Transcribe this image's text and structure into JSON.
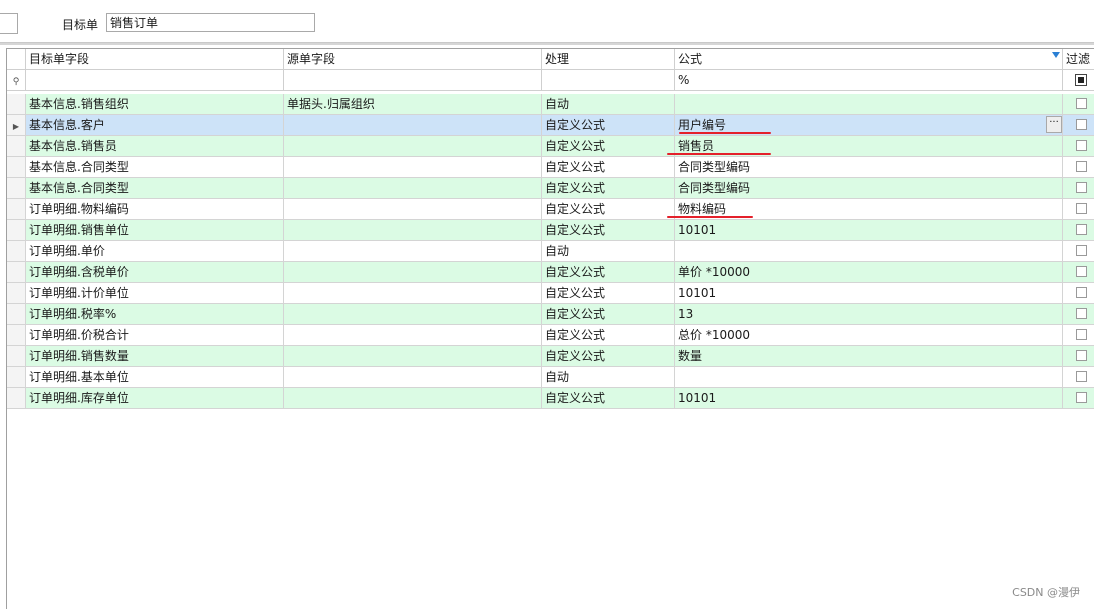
{
  "toolbar": {
    "target_label": "目标单",
    "target_value": "销售订单"
  },
  "grid": {
    "columns": [
      "目标单字段",
      "源单字段",
      "处理",
      "公式",
      "过滤"
    ],
    "filter_row": {
      "formula": "%"
    },
    "rows": [
      {
        "target": "基本信息.销售组织",
        "source": "单据头.归属组织",
        "process": "自动",
        "formula": ""
      },
      {
        "target": "基本信息.客户",
        "source": "",
        "process": "自定义公式",
        "formula": "用户编号"
      },
      {
        "target": "基本信息.销售员",
        "source": "",
        "process": "自定义公式",
        "formula": "销售员"
      },
      {
        "target": "基本信息.合同类型",
        "source": "",
        "process": "自定义公式",
        "formula": "合同类型编码"
      },
      {
        "target": "基本信息.合同类型",
        "source": "",
        "process": "自定义公式",
        "formula": "合同类型编码"
      },
      {
        "target": "订单明细.物料编码",
        "source": "",
        "process": "自定义公式",
        "formula": "物料编码"
      },
      {
        "target": "订单明细.销售单位",
        "source": "",
        "process": "自定义公式",
        "formula": "10101"
      },
      {
        "target": "订单明细.单价",
        "source": "",
        "process": "自动",
        "formula": ""
      },
      {
        "target": "订单明细.含税单价",
        "source": "",
        "process": "自定义公式",
        "formula": "单价 *10000"
      },
      {
        "target": "订单明细.计价单位",
        "source": "",
        "process": "自定义公式",
        "formula": "10101"
      },
      {
        "target": "订单明细.税率%",
        "source": "",
        "process": "自定义公式",
        "formula": "13"
      },
      {
        "target": "订单明细.价税合计",
        "source": "",
        "process": "自定义公式",
        "formula": "总价 *10000"
      },
      {
        "target": "订单明细.销售数量",
        "source": "",
        "process": "自定义公式",
        "formula": "数量"
      },
      {
        "target": "订单明细.基本单位",
        "source": "",
        "process": "自动",
        "formula": ""
      },
      {
        "target": "订单明细.库存单位",
        "source": "",
        "process": "自定义公式",
        "formula": "10101"
      }
    ]
  },
  "watermark": "CSDN @漫伊",
  "colors": {
    "row_green": "#dbfbe4",
    "row_selected": "#cde3f8",
    "annotation_red": "#e4202b",
    "filter_icon_blue": "#2a7fd4"
  },
  "icons": {
    "filter": "funnel-icon",
    "pin": "pin-icon",
    "current_row": "row-pointer-icon",
    "ellipsis": "ellipsis-icon"
  }
}
